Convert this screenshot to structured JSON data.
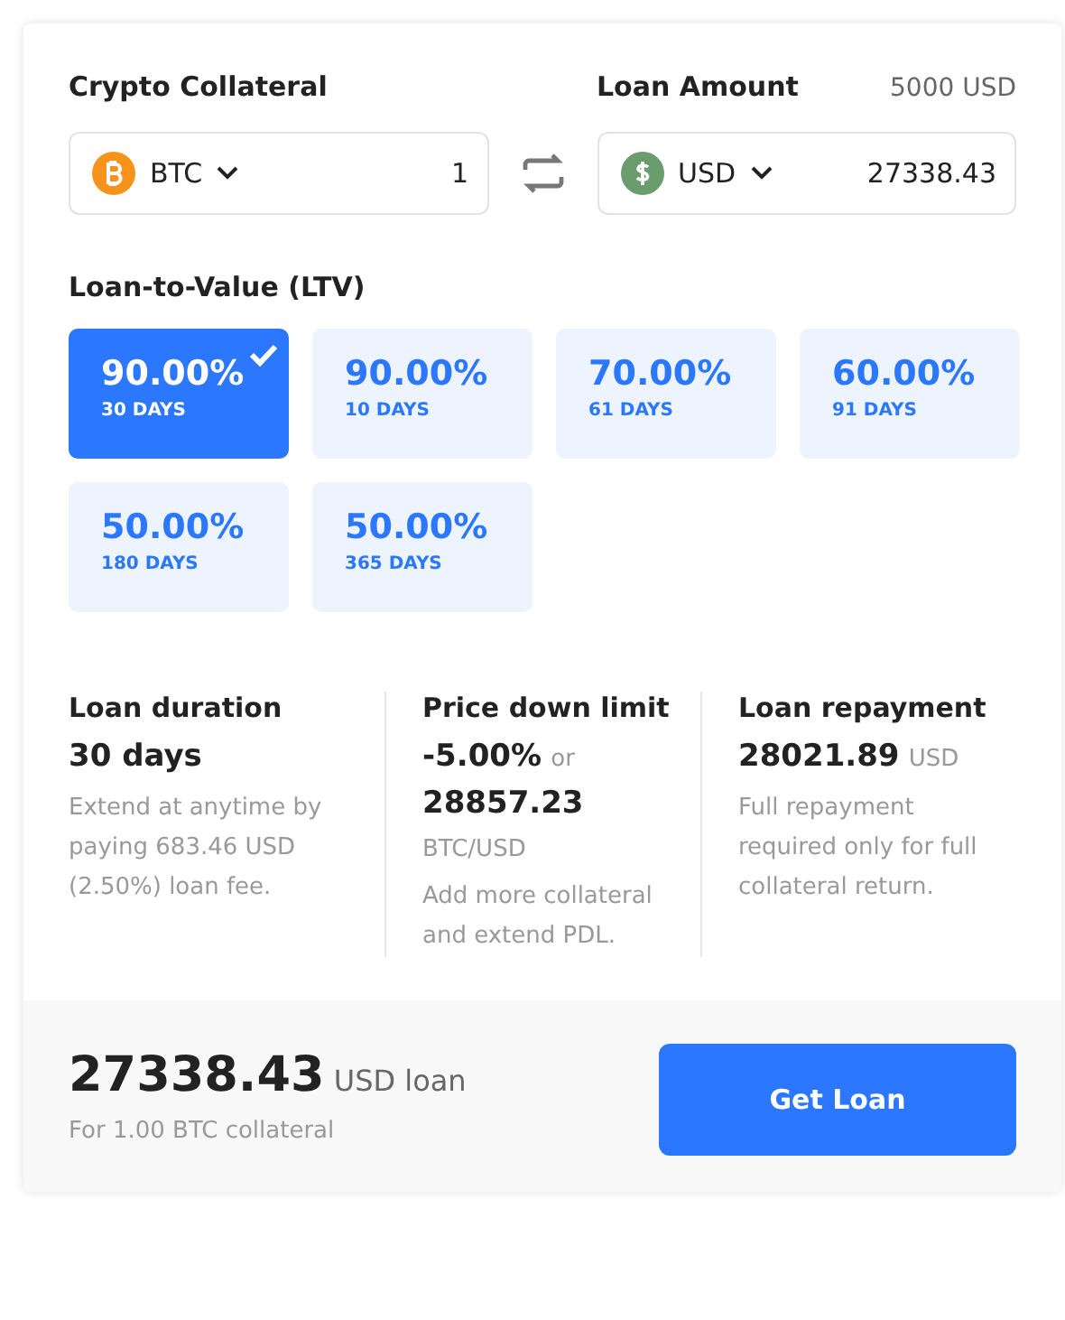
{
  "collateral": {
    "label": "Crypto Collateral",
    "currency": "BTC",
    "amount": "1"
  },
  "loan": {
    "label": "Loan Amount",
    "limit": "5000 USD",
    "currency": "USD",
    "amount": "27338.43"
  },
  "ltv": {
    "label": "Loan-to-Value (LTV)",
    "options": [
      {
        "percent": "90.00%",
        "days": "30 DAYS",
        "selected": true
      },
      {
        "percent": "90.00%",
        "days": "10 DAYS",
        "selected": false
      },
      {
        "percent": "70.00%",
        "days": "61 DAYS",
        "selected": false
      },
      {
        "percent": "60.00%",
        "days": "91 DAYS",
        "selected": false
      },
      {
        "percent": "50.00%",
        "days": "180 DAYS",
        "selected": false
      },
      {
        "percent": "50.00%",
        "days": "365 DAYS",
        "selected": false
      }
    ]
  },
  "details": [
    {
      "title": "Loan duration",
      "value": "30 days",
      "note": "Extend at anytime by paying 683.46 USD (2.50%) loan fee."
    },
    {
      "title": "Price down limit",
      "value": "-5.00%",
      "connector": "or",
      "value_2": "28857.23",
      "unit": "BTC/USD",
      "note": "Add more collateral and extend PDL."
    },
    {
      "title": "Loan repayment",
      "value": "28021.89",
      "unit": "USD",
      "note": "Full repayment required only for full collateral return."
    }
  ],
  "summary": {
    "amount": "27338.43",
    "unit": "USD loan",
    "note": "For 1.00 BTC collateral",
    "button": "Get Loan"
  }
}
